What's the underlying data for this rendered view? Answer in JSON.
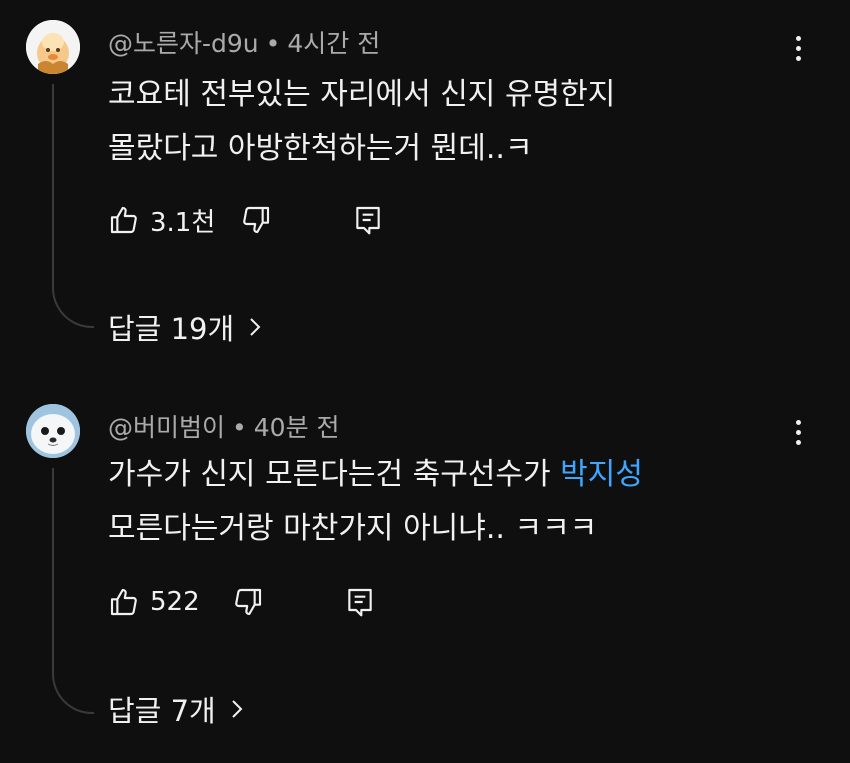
{
  "comments": [
    {
      "author": "@노른자-d9u",
      "separator": "•",
      "time": "4시간 전",
      "lines": [
        "코요테 전부있는 자리에서 신지 유명한지",
        "몰랐다고 아방한척하는거 뭔데..ㅋ"
      ],
      "likes": "3.1천",
      "replies_label": "답글 19개",
      "avatar_icon": "duck-face-avatar"
    },
    {
      "author": "@버미범이",
      "separator": "•",
      "time": "40분 전",
      "line1_text": "가수가 신지 모른다는건 축구선수가 ",
      "line1_mention": "박지성",
      "line2": "모른다는거랑 마찬가지 아니냐.. ㅋㅋㅋ",
      "likes": "522",
      "replies_label": "답글 7개",
      "avatar_icon": "seal-face-avatar"
    }
  ],
  "colors": {
    "background": "#0f0f0f",
    "text": "#f1f1f1",
    "meta": "#aaaaaa",
    "mention": "#3ea6ff"
  }
}
